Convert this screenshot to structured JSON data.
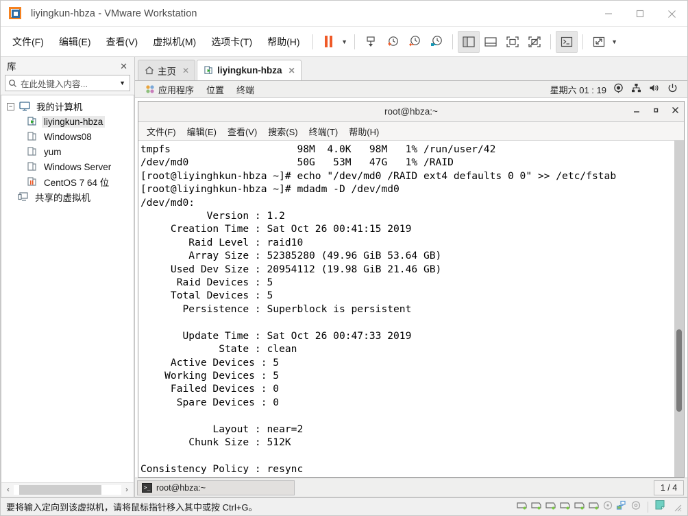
{
  "window": {
    "title": "liyingkun-hbza - VMware Workstation",
    "app_icon": "vmware-logo-icon",
    "controls": {
      "minimize": "minimize-icon",
      "maximize": "maximize-icon",
      "close": "close-icon"
    }
  },
  "menubar": {
    "items": [
      {
        "label": "文件(F)",
        "name": "menu-file"
      },
      {
        "label": "编辑(E)",
        "name": "menu-edit"
      },
      {
        "label": "查看(V)",
        "name": "menu-view"
      },
      {
        "label": "虚拟机(M)",
        "name": "menu-vm"
      },
      {
        "label": "选项卡(T)",
        "name": "menu-tabs"
      },
      {
        "label": "帮助(H)",
        "name": "menu-help"
      }
    ]
  },
  "toolbar": {
    "buttons": [
      {
        "name": "power-pause-button",
        "icon": "pause-icon"
      },
      {
        "name": "power-dropdown",
        "icon": "chevron-down-icon"
      },
      {
        "name": "manage-snapshot-button",
        "icon": "snapshot-manager-icon"
      },
      {
        "name": "take-snapshot-button",
        "icon": "clock-plus-icon"
      },
      {
        "name": "revert-snapshot-button",
        "icon": "clock-back-icon"
      },
      {
        "name": "snapshot-manager-button",
        "icon": "clock-wrench-icon"
      },
      {
        "name": "show-library-button",
        "icon": "library-panel-icon"
      },
      {
        "name": "show-thumbnail-bar-button",
        "icon": "thumbnail-bar-icon"
      },
      {
        "name": "enter-fullscreen-button",
        "icon": "fullscreen-icon"
      },
      {
        "name": "unity-mode-button",
        "icon": "unity-mode-icon"
      },
      {
        "name": "console-view-button",
        "icon": "terminal-icon"
      },
      {
        "name": "stretch-guest-button",
        "icon": "stretch-icon"
      },
      {
        "name": "stretch-dropdown",
        "icon": "chevron-down-icon"
      }
    ]
  },
  "sidebar": {
    "panel_title": "库",
    "close_icon": "close-icon",
    "search": {
      "placeholder": "在此处键入内容...",
      "value": "",
      "icon": "search-icon",
      "caret": "chevron-down-icon"
    },
    "tree": [
      {
        "label": "我的计算机",
        "name": "tree-my-computer",
        "icon": "computer-icon",
        "level": 0,
        "expander": "−",
        "selected": false
      },
      {
        "label": "liyingkun-hbza",
        "name": "tree-vm-liyingkun-hbza",
        "icon": "vm-running-icon",
        "level": 1,
        "selected": true
      },
      {
        "label": "Windows08",
        "name": "tree-vm-windows08",
        "icon": "vm-off-icon",
        "level": 1,
        "selected": false
      },
      {
        "label": "yum",
        "name": "tree-vm-yum",
        "icon": "vm-off-icon",
        "level": 1,
        "selected": false
      },
      {
        "label": "Windows Server",
        "name": "tree-vm-windows-server",
        "icon": "vm-off-icon",
        "level": 1,
        "selected": false
      },
      {
        "label": "CentOS 7 64 位",
        "name": "tree-vm-centos7",
        "icon": "vm-suspended-icon",
        "level": 1,
        "selected": false
      },
      {
        "label": "共享的虚拟机",
        "name": "tree-shared-vms",
        "icon": "shared-vm-icon",
        "level": 0,
        "selected": false
      }
    ],
    "hscroll": {
      "left_arrow": "‹",
      "right_arrow": "›"
    }
  },
  "tabs": [
    {
      "label": "主页",
      "name": "tab-home",
      "icon": "home-icon",
      "active": false,
      "close_icon": "close-icon"
    },
    {
      "label": "liyingkun-hbza",
      "name": "tab-liyingkun-hbza",
      "icon": "vm-running-icon",
      "active": true,
      "close_icon": "close-icon"
    }
  ],
  "guest": {
    "top_panel": {
      "items": [
        {
          "label": "应用程序",
          "name": "gnome-menu-applications",
          "icon": "applications-icon"
        },
        {
          "label": "位置",
          "name": "gnome-menu-places"
        },
        {
          "label": "终端",
          "name": "gnome-menu-terminal"
        }
      ],
      "clock": "星期六 01 : 19",
      "tray": [
        {
          "name": "record-indicator-icon",
          "icon": "record-icon"
        },
        {
          "name": "network-indicator-icon",
          "icon": "network-icon"
        },
        {
          "name": "volume-indicator-icon",
          "icon": "volume-icon"
        },
        {
          "name": "power-indicator-icon",
          "icon": "power-icon"
        }
      ]
    },
    "terminal": {
      "title": "root@hbza:~",
      "controls": {
        "minimize": "minimize-icon",
        "maximize": "maximize-icon",
        "close": "close-icon"
      },
      "menu": [
        {
          "label": "文件(F)",
          "name": "terminal-menu-file"
        },
        {
          "label": "编辑(E)",
          "name": "terminal-menu-edit"
        },
        {
          "label": "查看(V)",
          "name": "terminal-menu-view"
        },
        {
          "label": "搜索(S)",
          "name": "terminal-menu-search"
        },
        {
          "label": "终端(T)",
          "name": "terminal-menu-terminal"
        },
        {
          "label": "帮助(H)",
          "name": "terminal-menu-help"
        }
      ],
      "content": "tmpfs                     98M  4.0K   98M   1% /run/user/42\n/dev/md0                  50G   53M   47G   1% /RAID\n[root@liyinghkun-hbza ~]# echo \"/dev/md0 /RAID ext4 defaults 0 0\" >> /etc/fstab\n[root@liyinghkun-hbza ~]# mdadm -D /dev/md0\n/dev/md0:\n           Version : 1.2\n     Creation Time : Sat Oct 26 00:41:15 2019\n        Raid Level : raid10\n        Array Size : 52385280 (49.96 GiB 53.64 GB)\n     Used Dev Size : 20954112 (19.98 GiB 21.46 GB)\n      Raid Devices : 5\n     Total Devices : 5\n       Persistence : Superblock is persistent\n\n       Update Time : Sat Oct 26 00:47:33 2019\n             State : clean\n     Active Devices : 5\n    Working Devices : 5\n     Failed Devices : 0\n      Spare Devices : 0\n\n            Layout : near=2\n        Chunk Size : 512K\n\nConsistency Policy : resync",
      "scrollbar": "vertical-scrollbar"
    },
    "taskbar": {
      "task": {
        "label": "root@hbza:~",
        "name": "taskbar-item-terminal",
        "icon": "terminal-icon"
      },
      "workspace_switcher": "1 / 4"
    }
  },
  "statusbar": {
    "message": "要将输入定向到该虚拟机，请将鼠标指针移入其中或按 Ctrl+G。",
    "devices": [
      {
        "name": "status-hard-disk-1",
        "icon": "hard-disk-icon"
      },
      {
        "name": "status-hard-disk-2",
        "icon": "hard-disk-icon"
      },
      {
        "name": "status-hard-disk-3",
        "icon": "hard-disk-icon"
      },
      {
        "name": "status-hard-disk-4",
        "icon": "hard-disk-icon"
      },
      {
        "name": "status-hard-disk-5",
        "icon": "hard-disk-icon"
      },
      {
        "name": "status-hard-disk-6",
        "icon": "hard-disk-icon"
      },
      {
        "name": "status-cd-dvd",
        "icon": "cd-dvd-icon"
      },
      {
        "name": "status-network-adapter",
        "icon": "network-icon"
      },
      {
        "name": "status-sound-card",
        "icon": "disc-icon"
      }
    ],
    "message_note": {
      "name": "status-message-log",
      "icon": "note-icon"
    },
    "grip": "resize-grip-icon"
  },
  "colors": {
    "accent_orange": "#ef5a28",
    "accent_blue": "#2e6da4",
    "running_green": "#39a43a",
    "window_bg": "#f0f0f0",
    "terminal_bg": "#ffffff",
    "terminal_fg": "#000000"
  }
}
